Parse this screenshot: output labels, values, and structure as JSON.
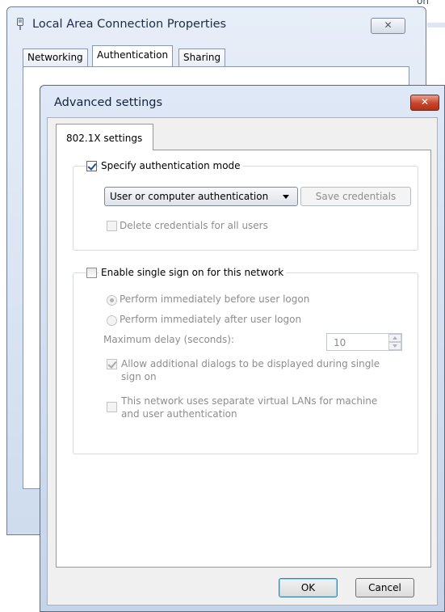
{
  "background": {
    "corner_text": "on"
  },
  "back_window": {
    "title": "Local Area Connection Properties",
    "close_glyph": "✕",
    "tabs": [
      {
        "label": "Networking",
        "active": false
      },
      {
        "label": "Authentication",
        "active": true
      },
      {
        "label": "Sharing",
        "active": false
      }
    ]
  },
  "dialog": {
    "title": "Advanced settings",
    "close_glyph": "✕",
    "tab": "802.1X settings",
    "auth_group": {
      "checkbox_label": "Specify authentication mode",
      "checked": true,
      "mode_selected": "User or computer authentication",
      "save_credentials_label": "Save credentials",
      "delete_credentials_label": "Delete credentials for all users",
      "delete_credentials_checked": false
    },
    "sso_group": {
      "checkbox_label": "Enable single sign on for this network",
      "checked": false,
      "radio_before_label": "Perform immediately before user logon",
      "radio_before_selected": true,
      "radio_after_label": "Perform immediately after user logon",
      "radio_after_selected": false,
      "max_delay_label": "Maximum delay (seconds):",
      "max_delay_value": "10",
      "allow_dialogs_label_line1": "Allow additional dialogs to be displayed during single",
      "allow_dialogs_label_line2": "sign on",
      "allow_dialogs_checked": true,
      "vlan_label_line1": "This network uses separate virtual LANs for machine",
      "vlan_label_line2": "and user authentication",
      "vlan_checked": false
    },
    "ok_label": "OK",
    "cancel_label": "Cancel"
  },
  "colors": {
    "title_bar": "#dfe8f6",
    "close_red": "#c8432a",
    "disabled_text": "#8d8d8d",
    "default_button_border": "#3c7fb1"
  }
}
